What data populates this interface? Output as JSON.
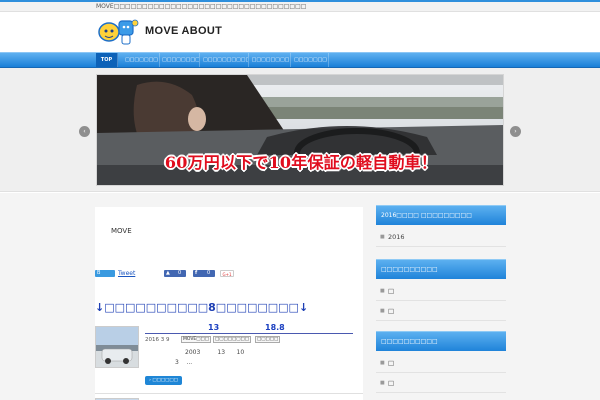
{
  "top_strip": {
    "text": "MOVE□□□□□□□□□□□□□□□□□□□□□□□□□□□□□□□□□□"
  },
  "header": {
    "site_title": "MOVE ABOUT",
    "logo_icon": "mascot-logo-icon"
  },
  "nav": {
    "items": [
      {
        "label": "TOP",
        "active": true
      },
      {
        "label": "□□□□□□□",
        "active": false
      },
      {
        "label": "□□□□□□□□",
        "active": false
      },
      {
        "label": "□□□□□□□□□□",
        "active": false
      },
      {
        "label": "□□□□□□□□",
        "active": false
      },
      {
        "label": "□□□□□□□",
        "active": false
      }
    ]
  },
  "slider": {
    "caption": "60万円以下で10年保証の軽自動車！",
    "prev_label": "‹",
    "next_label": "›"
  },
  "main": {
    "intro": "MOVE",
    "share": {
      "hatena_label": "B",
      "tweet_label": "Tweet",
      "like_count": "0",
      "fb_count": "0",
      "gplus_label": "G+1"
    },
    "ranking_heading": "↓□□□□□□□□□□8□□□□□□□□↓",
    "post": {
      "title_num_1": "13",
      "title_num_2": "18.8",
      "date": "2016 3 9",
      "tags": [
        "MOVE□□□",
        "□□□□□□□□",
        "□□□□□"
      ],
      "excerpt_line1": "2003         13      10",
      "excerpt_line2": "3    ...",
      "more_label": "□□□□□□"
    }
  },
  "sidebar": {
    "widgets": [
      {
        "title": "2016□□□□ □□□□□□□□□",
        "items": [
          "2016"
        ]
      },
      {
        "title": "□□□□□□□□□□",
        "items": [
          "□",
          "□"
        ]
      },
      {
        "title": "□□□□□□□□□□",
        "items": [
          "□",
          "□"
        ]
      }
    ]
  },
  "colors": {
    "accent_blue": "#1f83d9",
    "caption_red": "#e00d1e",
    "heading_blue": "#1e3fb4"
  }
}
